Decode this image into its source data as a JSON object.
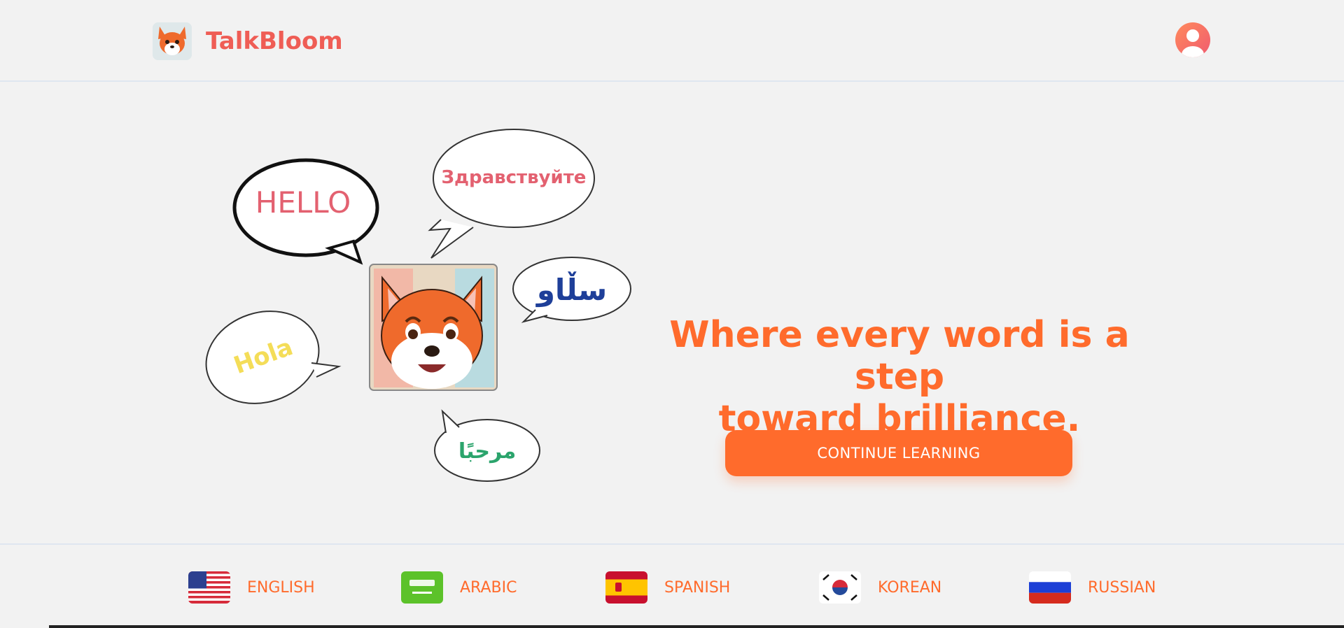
{
  "header": {
    "brand_name": "TalkBloom",
    "logo_icon": "fox-logo-icon",
    "avatar_icon": "user-avatar-icon"
  },
  "hero": {
    "illustration": {
      "bubbles": {
        "hello": "HELLO",
        "russian": "Здравствуйте",
        "kurdish": "سڵاو",
        "spanish": "Hola",
        "arabic": "مرحبًا"
      }
    },
    "headline_line1": "Where every word is a step",
    "headline_line2": "toward brilliance.",
    "cta_label": "CONTINUE LEARNING"
  },
  "languages": [
    {
      "label": "ENGLISH",
      "flag_icon": "us-flag-icon"
    },
    {
      "label": "ARABIC",
      "flag_icon": "arabic-flag-icon"
    },
    {
      "label": "SPANISH",
      "flag_icon": "spain-flag-icon"
    },
    {
      "label": "KOREAN",
      "flag_icon": "korea-flag-icon"
    },
    {
      "label": "RUSSIAN",
      "flag_icon": "russia-flag-icon"
    }
  ],
  "colors": {
    "brand": "#ef5d55",
    "accent": "#ff6b2c",
    "background": "#f2f2f2"
  }
}
